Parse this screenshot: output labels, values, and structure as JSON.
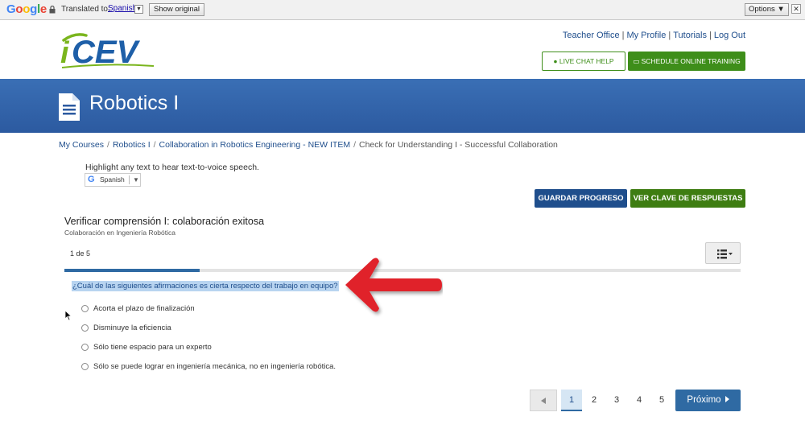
{
  "translate_bar": {
    "logo": "Google",
    "translated_to": "Translated to:",
    "language": "Spanish",
    "show_original": "Show original",
    "options": "Options ▼",
    "close": "✕"
  },
  "header": {
    "logo": "iCEV",
    "links": [
      "Teacher Office",
      "My Profile",
      "Tutorials",
      "Log Out"
    ],
    "live_chat": "LIVE CHAT HELP",
    "schedule": "SCHEDULE ONLINE TRAINING"
  },
  "banner": {
    "title": "Robotics I"
  },
  "breadcrumb": {
    "items": [
      "My Courses",
      "Robotics I",
      "Collaboration in Robotics Engineering - NEW ITEM"
    ],
    "current": "Check for Understanding I - Successful Collaboration"
  },
  "tts": {
    "hint": "Highlight any text to hear text-to-voice speech.",
    "widget_logo": "G",
    "widget_language": "Spanish",
    "widget_caret": "▼"
  },
  "actions": {
    "save": "GUARDAR PROGRESO",
    "answer_key": "VER CLAVE DE RESPUESTAS"
  },
  "quiz": {
    "title": "Verificar comprensión I: colaboración exitosa",
    "subtitle": "Colaboración en Ingeniería Robótica",
    "counter": "1 de 5",
    "progress": 0.2,
    "question": "¿Cuál de las siguientes afirmaciones es cierta respecto del trabajo en equipo?",
    "answers": [
      "Acorta el plazo de finalización",
      "Disminuye la eficiencia",
      "Sólo tiene espacio para un experto",
      "Sólo se puede lograr en ingeniería mecánica, no en ingeniería robótica."
    ]
  },
  "pagination": {
    "pages": [
      "1",
      "2",
      "3",
      "4",
      "5"
    ],
    "active_page": "1",
    "next": "Próximo"
  },
  "colors": {
    "brand_blue": "#2c5aa0",
    "brand_green": "#3e8e1a",
    "highlight": "#b8d4f0",
    "arrow_red": "#e0222b"
  }
}
